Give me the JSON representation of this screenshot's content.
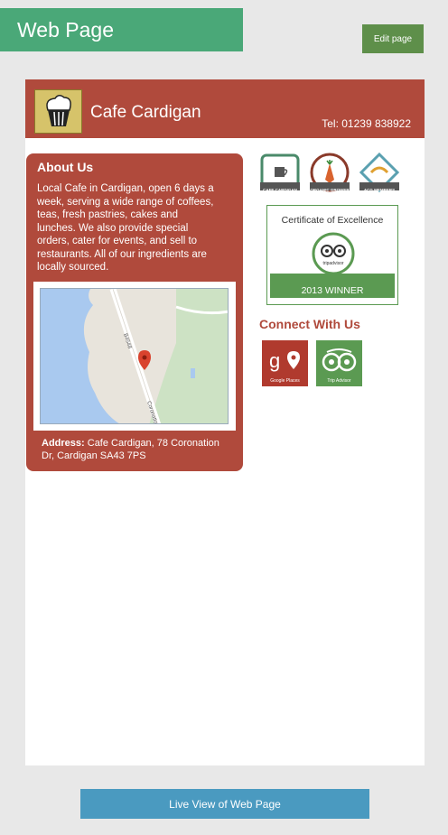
{
  "topbar": {
    "title": "Web Page",
    "edit_label": "Edit page"
  },
  "header": {
    "cafe_name": "Cafe Cardigan",
    "tel": "Tel: 01239 838922"
  },
  "about": {
    "heading": "About Us",
    "body": "Local Cafe in Cardigan, open 6 days a week, serving a wide range of coffees, teas, fresh pastries, cakes and lunches. We also provide special orders, cater for events, and sell to restaurants. All of our ingredients are locally sourced.",
    "address_label": "Address:",
    "address_text": " Cafe Cardigan, 78 Coronation Dr, Cardigan SA43 7PS"
  },
  "map": {
    "road_label_1": "B4548",
    "road_label_2": "Coronation"
  },
  "badges": [
    {
      "caption": "CAFE CARDIGAN",
      "icon": "coffee-cup-icon",
      "color": "#4a8a6a"
    },
    {
      "caption": "ORGANIC GROWER",
      "icon": "carrot-icon",
      "color": "#8a3a2a"
    },
    {
      "caption": "ACG MEMBERS",
      "icon": "handshake-icon",
      "color": "#5aa0b0"
    }
  ],
  "certificate": {
    "title": "Certificate of Excellence",
    "brand": "tripadvisor",
    "winner": "2013 WINNER"
  },
  "connect": {
    "heading": "Connect With Us",
    "google_caption": "Google Places",
    "trip_caption": "Trip Advisor"
  },
  "footer": {
    "live_label": "Live View of Web Page"
  }
}
